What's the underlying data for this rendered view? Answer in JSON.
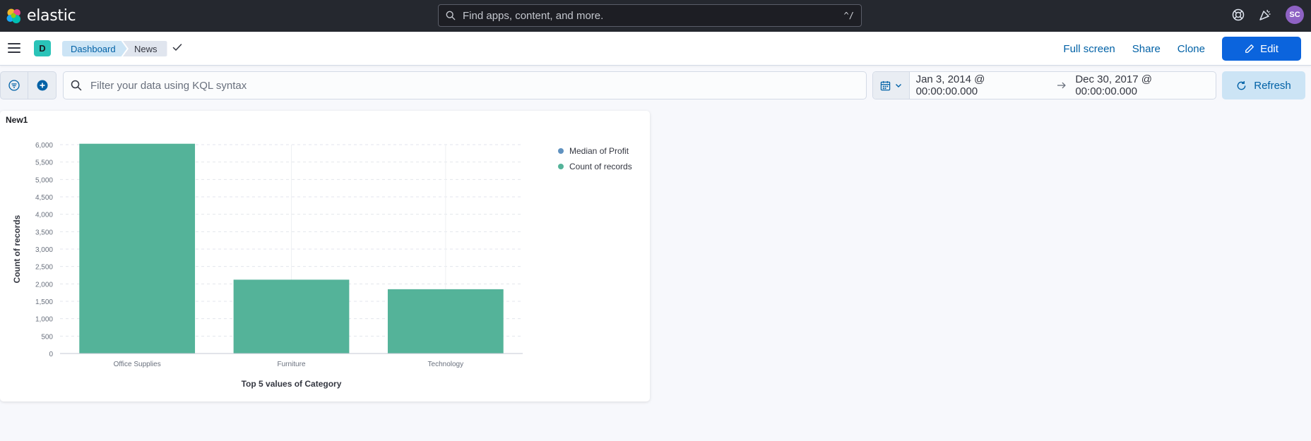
{
  "header": {
    "brand": "elastic",
    "search_placeholder": "Find apps, content, and more.",
    "search_shortcut": "^/",
    "avatar_initials": "SC"
  },
  "navbar": {
    "space_initial": "D",
    "breadcrumbs": [
      "Dashboard",
      "News"
    ],
    "actions": {
      "full_screen": "Full screen",
      "share": "Share",
      "clone": "Clone",
      "edit": "Edit"
    }
  },
  "query": {
    "kql_placeholder": "Filter your data using KQL syntax",
    "start_date": "Jan 3, 2014 @ 00:00:00.000",
    "end_date": "Dec 30, 2017 @ 00:00:00.000",
    "refresh_label": "Refresh"
  },
  "panel": {
    "title": "New1"
  },
  "chart_data": {
    "type": "bar",
    "categories": [
      "Office Supplies",
      "Furniture",
      "Technology"
    ],
    "series": [
      {
        "name": "Count of records",
        "values": [
          6026,
          2121,
          1847
        ],
        "color": "#54b399"
      }
    ],
    "legend": [
      {
        "name": "Median of Profit",
        "color": "#6092c0"
      },
      {
        "name": "Count of records",
        "color": "#54b399"
      }
    ],
    "legend_position": "right",
    "xlabel": "Top 5 values of Category",
    "ylabel": "Count of records",
    "ylim": [
      0,
      6000
    ],
    "yticks": [
      0,
      500,
      1000,
      1500,
      2000,
      2500,
      3000,
      3500,
      4000,
      4500,
      5000,
      5500,
      6000
    ],
    "ytick_labels": [
      "0",
      "500",
      "1,000",
      "1,500",
      "2,000",
      "2,500",
      "3,000",
      "3,500",
      "4,000",
      "4,500",
      "5,000",
      "5,500",
      "6,000"
    ],
    "grid": true
  },
  "colors": {
    "header_bg": "#25282f",
    "primary": "#0b64dd",
    "link": "#0061a6",
    "bar": "#54b399"
  }
}
